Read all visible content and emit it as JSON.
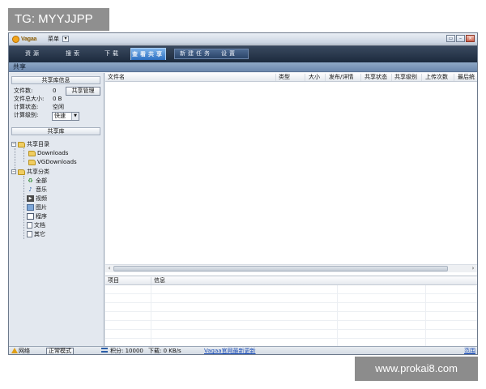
{
  "watermarks": {
    "top": "TG: MYYJJPP",
    "bottom": "www.prokai8.com"
  },
  "titlebar": {
    "logo_text": "Vagaa",
    "menu_label": "菜单",
    "menu_arrow": "▾",
    "buttons": [
      "▭",
      "–",
      "×"
    ]
  },
  "nav": {
    "tabs": [
      {
        "label": "资源"
      },
      {
        "label": "搜索"
      },
      {
        "label": "下载"
      },
      {
        "label": "查看共享",
        "active": true
      },
      {
        "label": "新建任务"
      },
      {
        "label": "设置"
      }
    ]
  },
  "section_title": "共享",
  "sidebar": {
    "info_header": "共享库信息",
    "file_count_label": "文件数:",
    "file_count_value": "0",
    "manage_button": "共享管理",
    "total_size_label": "文件总大小:",
    "total_size_value": "0 B",
    "calc_state_label": "计算状态:",
    "calc_state_value": "空闲",
    "calc_level_label": "计算级别:",
    "calc_level_value": "快速",
    "library_header": "共享库",
    "tree": {
      "dir_root": "共享目录",
      "dirs": [
        "Downloads",
        "VGDownloads"
      ],
      "cat_root": "共享分类",
      "cats": [
        "全部",
        "音乐",
        "视频",
        "图片",
        "程序",
        "文档",
        "其它"
      ]
    }
  },
  "table": {
    "columns": [
      "文件名",
      "类型",
      "大小",
      "发布/详情",
      "共享状态",
      "共享级别",
      "上传次数",
      "最后统"
    ]
  },
  "info": {
    "columns": [
      "项目",
      "信息"
    ]
  },
  "status": {
    "network": "网络",
    "mode": "正常模式",
    "points": "积分: 10000",
    "download": "下载: 0 KB/s",
    "update_link": "Vagaa官网最新更新",
    "right_link": "范围"
  },
  "colors": {
    "nav_bg": "#1c2a3d",
    "active_tab": "#2c6fc0",
    "section_bar": "#6c88ad",
    "link": "#1d4fb6"
  }
}
